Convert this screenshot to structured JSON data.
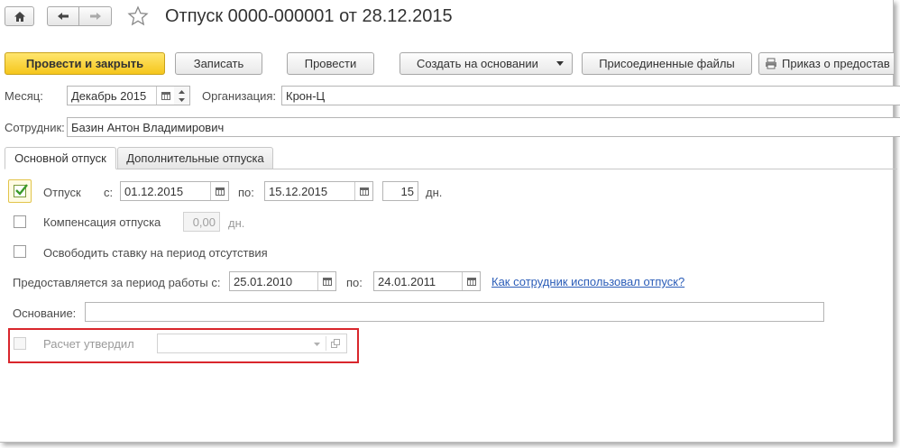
{
  "window": {
    "title": "Отпуск 0000-000001 от 28.12.2015"
  },
  "nav": {
    "home_icon": "home-icon",
    "back_icon": "arrow-left-icon",
    "forward_icon": "arrow-right-icon",
    "star_icon": "star-icon"
  },
  "toolbar": {
    "post_close": "Провести и закрыть",
    "save": "Записать",
    "post": "Провести",
    "create_based": "Создать на основании",
    "attached_files": "Присоединенные файлы",
    "order": "Приказ о предостав"
  },
  "header": {
    "month_label": "Месяц:",
    "month_value": "Декабрь 2015",
    "org_label": "Организация:",
    "org_value": "Крон-Ц",
    "employee_label": "Сотрудник:",
    "employee_value": "Базин Антон Владимирович"
  },
  "tabs": [
    {
      "label": "Основной отпуск",
      "active": true
    },
    {
      "label": "Дополнительные отпуска",
      "active": false
    }
  ],
  "main": {
    "vacation_label": "Отпуск",
    "vacation_checked": true,
    "from_label": "с:",
    "date_from": "01.12.2015",
    "to_label": "по:",
    "date_to": "15.12.2015",
    "days": "15",
    "days_unit": "дн.",
    "compensation_label": "Компенсация отпуска",
    "compensation_days": "0,00",
    "compensation_unit": "дн.",
    "free_rate_label": "Освободить ставку на период отсутствия",
    "period_label": "Предоставляется за период работы с:",
    "period_from": "25.01.2010",
    "period_to_label": "по:",
    "period_to": "24.01.2011",
    "usage_link": "Как сотрудник использовал отпуск?",
    "basis_label": "Основание:",
    "basis_value": "",
    "approved_label": "Расчет утвердил",
    "approved_value": ""
  },
  "colors": {
    "primary_button": "#f5c61c",
    "highlight_box": "#d9262c",
    "link": "#2b5db8",
    "check_mark": "#3a9a2a"
  }
}
